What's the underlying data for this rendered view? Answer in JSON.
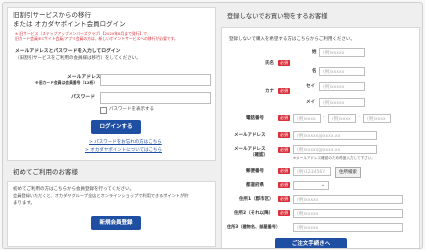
{
  "left": {
    "title1": "旧割引サービスからの移行",
    "title2": "または オカダヤポイント会員ログイン",
    "note1": "※ 旧サービス（ステップアップメンバーズクラブ）【2020年8月まで発行】で、",
    "note2": "旧カード会員/ECサイト会員/アプリ会員の方は、新しいポイントサービスへの移行が必要です。",
    "login_box_title": "メールアドレスとパスワードを入力してログイン",
    "login_box_sub": "（旧割引サービスをご利用の会員様は移行）をしてください。",
    "email_label": "メールアドレス",
    "email_sub": "※旧カード会員は会員番号（12桁）",
    "password_label": "パスワード",
    "show_password": "パスワードを表示する",
    "login_button": "ログインする",
    "forgot_link": "> パスワードをお忘れの方はこちら",
    "about_link": "> オカダヤポイントについてはこちら",
    "first_title": "初めてご利用のお客様",
    "first_text1": "初めてご利用の方はこちらから会員登録を行ってください。",
    "first_text2": "会員登録いただくと、オカダヤグループ全店とオンラインショップで利用できるポイントが貯",
    "first_text3": "まります。",
    "register_button": "新規会員登録"
  },
  "right": {
    "title": "登録しないでお買い物をするお客様",
    "intro": "登録しないで購入を希望する方はこちらからご利用ください。",
    "required": "必須",
    "name_label": "氏名",
    "kana_label": "カナ",
    "sei": "姓",
    "mei": "名",
    "sei_kana": "セイ",
    "mei_kana": "メイ",
    "sei_ph": "(例)xxxxx",
    "mei_ph": "(例)xxxxx",
    "phone_label": "電話番号",
    "phone_ph1": "(例)xxxx",
    "phone_ph2": "(例)xxxx",
    "phone_ph3": "(例)xxxx",
    "email_label": "メールアドレス",
    "email_ph": "(例)xxxxx@xxxx.xx",
    "email_confirm_label": "メールアドレス",
    "email_confirm_sub": "（確認）",
    "email_confirm_ph": "(例)xxxxx@xxxx.xx",
    "email_note": "※メールアドレス確認のため再度入力して下さい。",
    "zip_label": "郵便番号",
    "zip_ph": "(例)1234567",
    "zip_button": "住所検索",
    "pref_label": "都道府県",
    "addr1_label": "住所1（郡市区）",
    "addr1_ph": "(例)xxxxx",
    "addr2_label": "住所2（それ以降）",
    "addr2_ph": "(例)xxxxx",
    "addr3_label": "住所3（建物名、部屋番号）",
    "addr3_ph": "(例)xxxxx",
    "submit_button": "ご注文手続きへ"
  }
}
